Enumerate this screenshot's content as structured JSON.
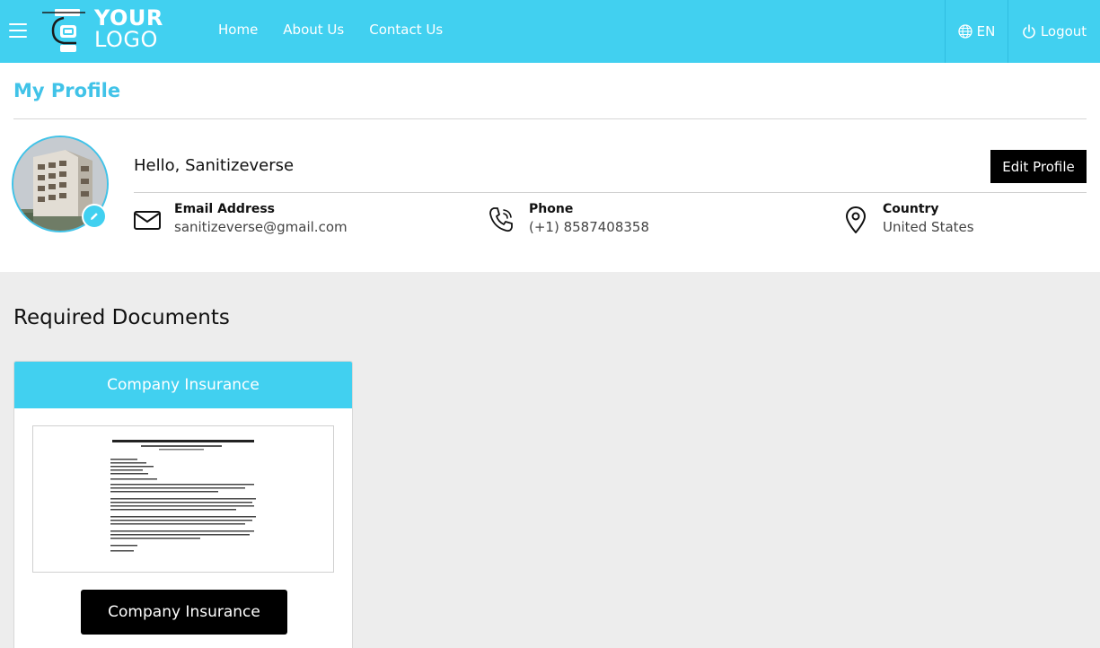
{
  "header": {
    "logo_line1": "YOUR",
    "logo_line2": "LOGO",
    "nav": [
      {
        "label": "Home"
      },
      {
        "label": "About Us"
      },
      {
        "label": "Contact Us"
      }
    ],
    "language": "EN",
    "logout": "Logout"
  },
  "profile": {
    "page_title": "My Profile",
    "greeting": "Hello, Sanitizeverse",
    "edit_button": "Edit Profile",
    "email": {
      "label": "Email Address",
      "value": "sanitizeverse@gmail.com"
    },
    "phone": {
      "label": "Phone",
      "value": "(+1) 8587408358"
    },
    "country": {
      "label": "Country",
      "value": "United States"
    }
  },
  "documents": {
    "title": "Required Documents",
    "cards": [
      {
        "header": "Company Insurance",
        "button": "Company Insurance"
      }
    ]
  },
  "colors": {
    "accent": "#41d0f0",
    "title_accent": "#41c3e8",
    "button_bg": "#000000",
    "page_bg": "#ededed"
  },
  "icons": {
    "menu": "hamburger-icon",
    "language": "globe-icon",
    "logout": "power-icon",
    "email": "envelope-icon",
    "phone": "phone-icon",
    "country": "map-pin-icon",
    "avatar_edit": "pencil-icon"
  }
}
